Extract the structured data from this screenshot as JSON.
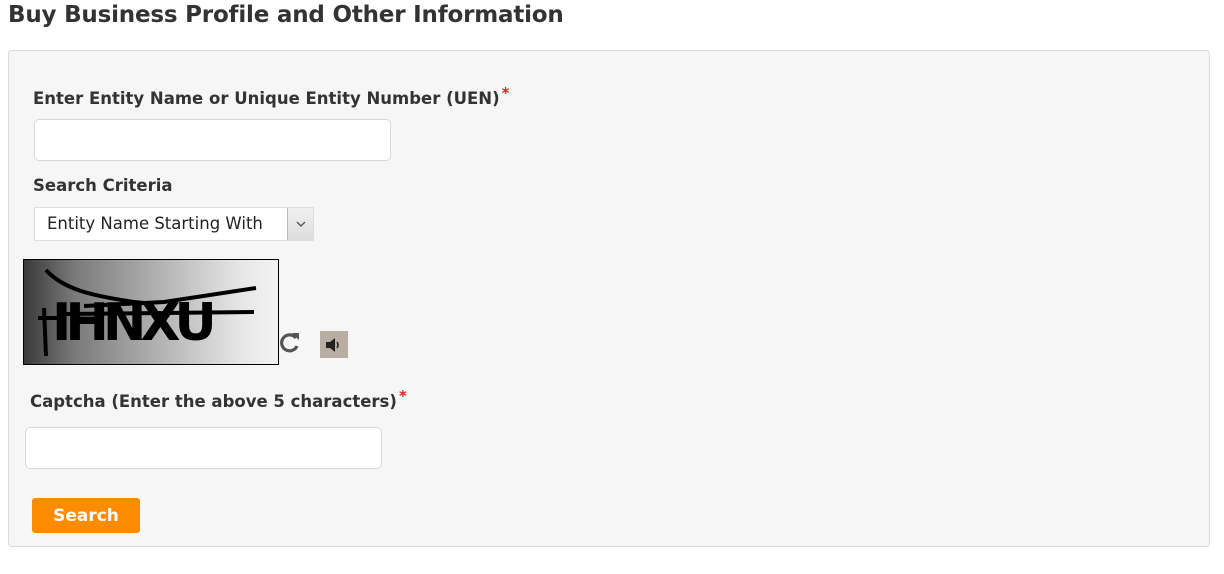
{
  "page": {
    "title": "Buy Business Profile and Other Information"
  },
  "form": {
    "entity_label": "Enter Entity Name or Unique Entity Number (UEN)",
    "entity_required_mark": "*",
    "entity_value": "",
    "entity_placeholder": "",
    "criteria_label": "Search Criteria",
    "criteria_selected": "Entity Name Starting With",
    "captcha_text": "IHNXU",
    "captcha_label": "Captcha (Enter the above 5 characters)",
    "captcha_required_mark": "*",
    "captcha_value": "",
    "captcha_placeholder": "",
    "search_label": "Search"
  },
  "icons": {
    "refresh": "refresh-icon",
    "audio": "speaker-icon",
    "dropdown": "chevron-down-icon"
  },
  "colors": {
    "accent": "#ff8c00",
    "required": "#e02020",
    "panel_bg": "#f6f6f6"
  }
}
